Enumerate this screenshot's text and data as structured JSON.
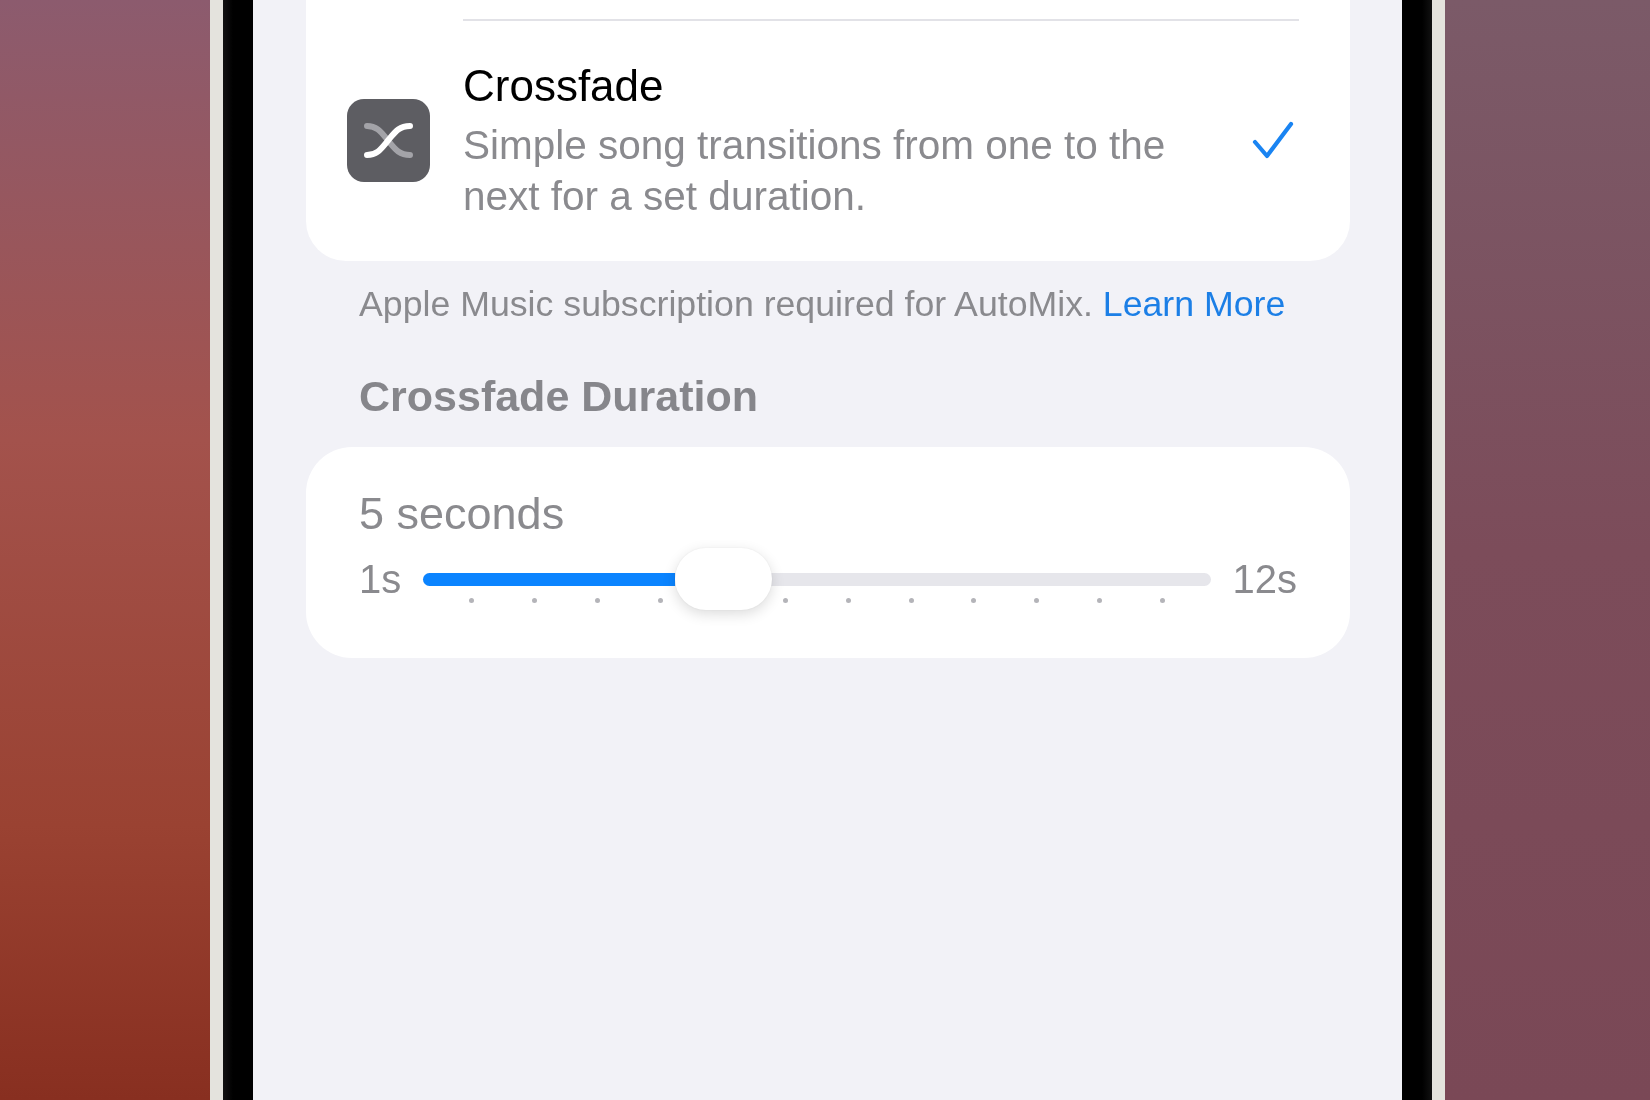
{
  "transition_options": [
    {
      "title": "Crossfade",
      "description": "Simple song transitions from one to the next for a set duration.",
      "selected": true
    }
  ],
  "footnote": {
    "text": "Apple Music subscription required for AutoMix.",
    "link": "Learn More"
  },
  "crossfade_duration": {
    "header": "Crossfade Duration",
    "value": "5 seconds",
    "min_label": "1s",
    "max_label": "12s",
    "level": 0.364
  }
}
